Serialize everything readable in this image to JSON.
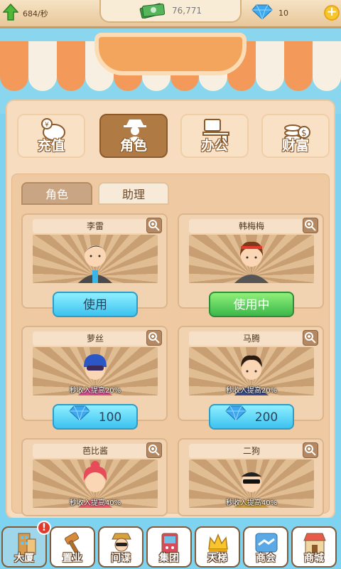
{
  "topbar": {
    "income_rate": "684/秒",
    "cash": "76,771",
    "gems": "10",
    "plus_icon": "plus-icon"
  },
  "categories": [
    {
      "label": "充值",
      "icon": "piggy-bank-icon",
      "active": false
    },
    {
      "label": "角色",
      "icon": "spy-agent-icon",
      "active": true
    },
    {
      "label": "办公",
      "icon": "office-desk-icon",
      "active": false
    },
    {
      "label": "财富",
      "icon": "coin-stack-icon",
      "active": false
    }
  ],
  "tabs": [
    {
      "label": "角色",
      "active": true
    },
    {
      "label": "助理",
      "active": false
    }
  ],
  "cards": [
    {
      "name": "李雷",
      "bonus": "",
      "button": "使用",
      "button_type": "use",
      "gem_cost": ""
    },
    {
      "name": "韩梅梅",
      "bonus": "",
      "button": "使用中",
      "button_type": "in-use",
      "gem_cost": ""
    },
    {
      "name": "萝丝",
      "bonus": "秒收入提高20%",
      "button": "100",
      "button_type": "buy",
      "gem_cost": "100"
    },
    {
      "name": "马腾",
      "bonus": "秒收入提高20%",
      "button": "200",
      "button_type": "buy",
      "gem_cost": "200"
    },
    {
      "name": "芭比酱",
      "bonus": "秒收入提高40%",
      "button": "",
      "button_type": "",
      "gem_cost": ""
    },
    {
      "name": "二狗",
      "bonus": "秒收入提高40%",
      "button": "",
      "button_type": "",
      "gem_cost": ""
    }
  ],
  "nav": [
    {
      "label": "大厦",
      "icon": "building-icon",
      "badge": "!"
    },
    {
      "label": "置业",
      "icon": "gavel-icon",
      "badge": ""
    },
    {
      "label": "间谍",
      "icon": "spy-icon",
      "badge": ""
    },
    {
      "label": "集团",
      "icon": "arcade-icon",
      "badge": ""
    },
    {
      "label": "天梯",
      "icon": "crown-icon",
      "badge": ""
    },
    {
      "label": "商会",
      "icon": "handshake-icon",
      "badge": ""
    },
    {
      "label": "商城",
      "icon": "shop-icon",
      "badge": ""
    }
  ],
  "colors": {
    "accent_orange": "#f3a55d",
    "panel": "#f7dcc0",
    "use_button": "#3cc2ef",
    "in_use_button": "#3cb84a",
    "badge_red": "#e23b2d"
  }
}
